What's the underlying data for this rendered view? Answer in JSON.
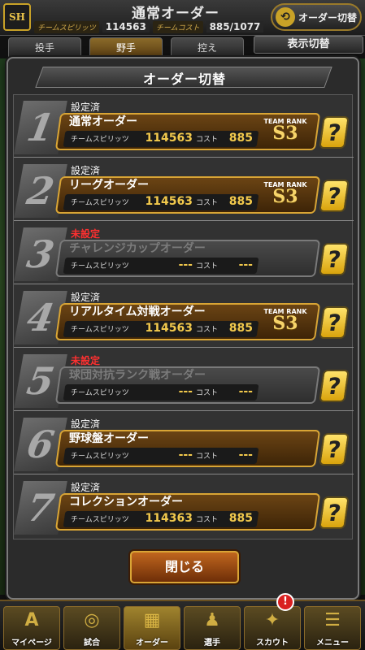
{
  "background": {
    "title": "通常オーダー",
    "logo_text": "SH",
    "team_spirit_label": "チームスピリッツ",
    "team_spirit_value": "114563",
    "team_cost_label": "チームコスト",
    "team_cost_value": "885/1077",
    "swap_button_label": "オーダー切替",
    "display_toggle_label": "表示切替",
    "tabs": [
      {
        "label": "投手"
      },
      {
        "label": "野手"
      },
      {
        "label": "控え"
      }
    ]
  },
  "dialog": {
    "title": "オーダー切替",
    "spirit_label": "チームスピリッツ",
    "cost_label": "コスト",
    "team_rank_label": "TEAM RANK",
    "help_label": "?",
    "close_label": "閉じる",
    "orders": [
      {
        "number": "1",
        "status": "設定済",
        "name": "通常オーダー",
        "spirit": "114563",
        "cost": "885",
        "rank": "S3"
      },
      {
        "number": "2",
        "status": "設定済",
        "name": "リーグオーダー",
        "spirit": "114563",
        "cost": "885",
        "rank": "S3"
      },
      {
        "number": "3",
        "status": "未設定",
        "name": "チャレンジカップオーダー",
        "spirit": "---",
        "cost": "---",
        "rank": ""
      },
      {
        "number": "4",
        "status": "設定済",
        "name": "リアルタイム対戦オーダー",
        "spirit": "114563",
        "cost": "885",
        "rank": "S3"
      },
      {
        "number": "5",
        "status": "未設定",
        "name": "球団対抗ランク戦オーダー",
        "spirit": "---",
        "cost": "---",
        "rank": ""
      },
      {
        "number": "6",
        "status": "設定済",
        "name": "野球盤オーダー",
        "spirit": "---",
        "cost": "---",
        "rank": ""
      },
      {
        "number": "7",
        "status": "設定済",
        "name": "コレクションオーダー",
        "spirit": "114363",
        "cost": "885",
        "rank": ""
      }
    ]
  },
  "bottom_nav": {
    "items": [
      {
        "label": "マイページ",
        "glyph": "A"
      },
      {
        "label": "試合",
        "glyph": "◎"
      },
      {
        "label": "オーダー",
        "glyph": "▦"
      },
      {
        "label": "選手",
        "glyph": "♟"
      },
      {
        "label": "スカウト",
        "glyph": "✦"
      },
      {
        "label": "メニュー",
        "glyph": "☰"
      }
    ],
    "scout_badge": "!"
  },
  "colors": {
    "accent_gold": "#d9a535",
    "value_yellow": "#f2c94c",
    "unset_red": "#ff3030",
    "close_orange": "#c0661e"
  }
}
